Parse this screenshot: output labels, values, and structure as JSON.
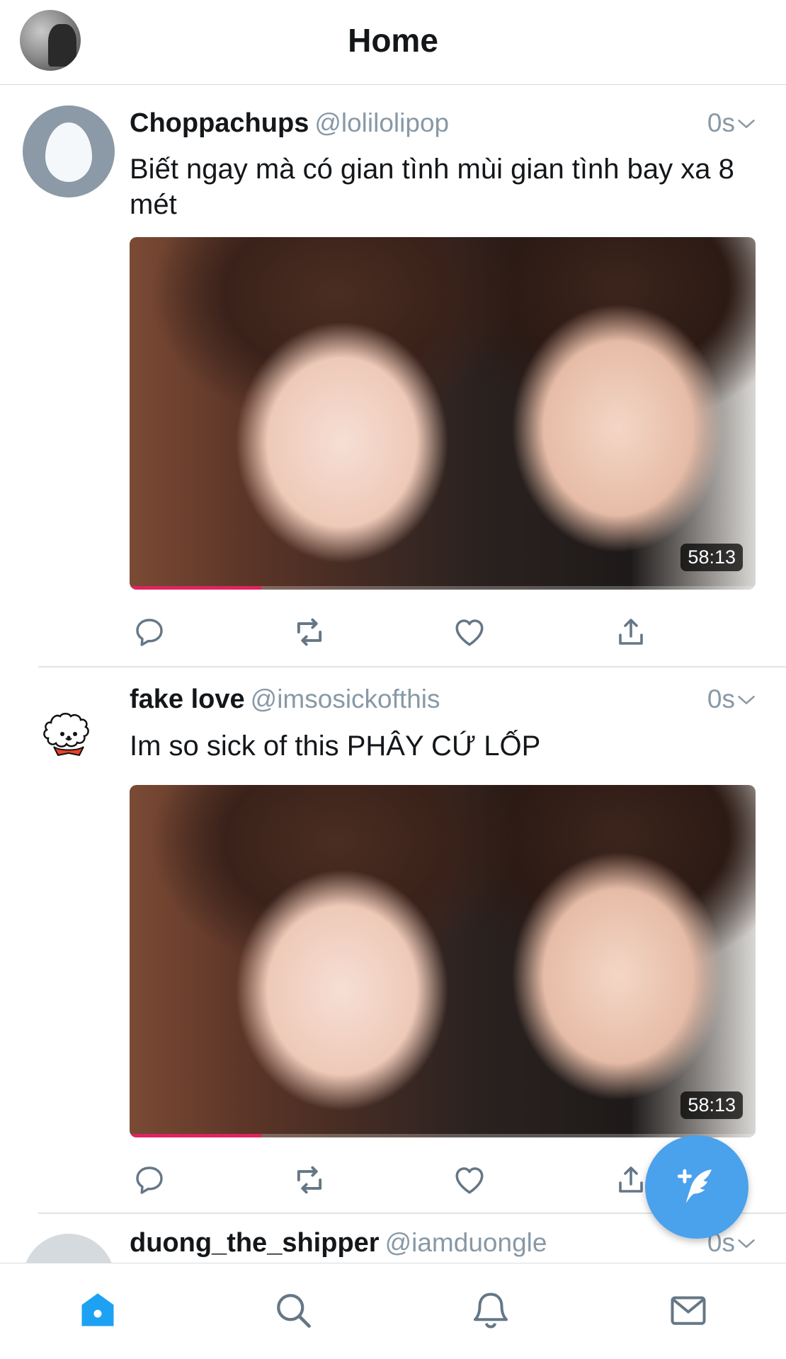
{
  "header": {
    "title": "Home"
  },
  "tweets": [
    {
      "name": "Choppachups",
      "handle": "@lolilolipop",
      "time": "0s",
      "text": "Biết ngay mà có gian tình mùi gian tình bay xa 8 mét",
      "media": {
        "duration": "58:13",
        "progress_fraction": 0.21
      }
    },
    {
      "name": "fake love",
      "handle": "@imsosickofthis",
      "time": "0s",
      "text": "Im so sick of this PHÂY CỨ LỐP",
      "media": {
        "duration": "58:13",
        "progress_fraction": 0.21
      }
    },
    {
      "name": "duong_the_shipper",
      "handle": "@iamduongle",
      "time": "0s"
    }
  ],
  "icons": {
    "reply": "reply-icon",
    "retweet": "retweet-icon",
    "like": "heart-icon",
    "share": "share-icon",
    "compose": "compose-tweet-icon",
    "tabs": [
      "home-icon",
      "search-icon",
      "notifications-icon",
      "messages-icon"
    ]
  },
  "colors": {
    "accent": "#1da1f2",
    "fab": "#4aa1ec",
    "text": "#14171a",
    "secondary_text": "#8899a6",
    "progress": "#e0245e"
  }
}
